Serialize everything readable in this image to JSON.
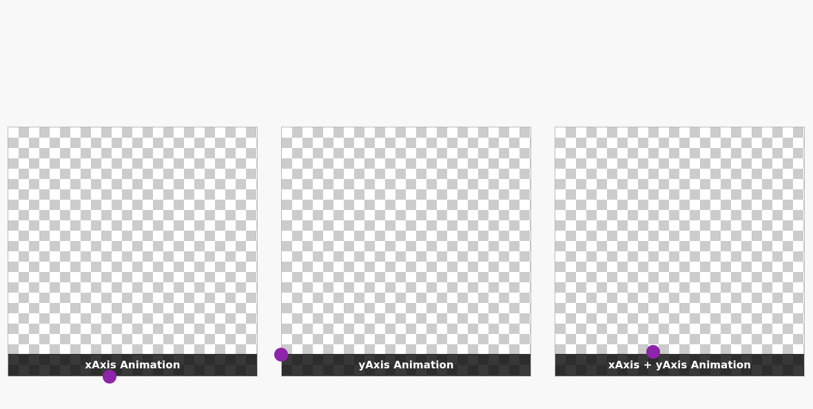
{
  "panels": [
    {
      "caption": "xAxis Animation"
    },
    {
      "caption": "yAxis Animation"
    },
    {
      "caption": "xAxis + yAxis Animation"
    }
  ],
  "colors": {
    "page_background": "#f8f8f8",
    "checker_light": "#ffffff",
    "checker_dark": "#cccccc",
    "caption_bar": "#1e1e1e",
    "caption_text": "#ffffff",
    "animated_dot": "#8e24aa"
  }
}
